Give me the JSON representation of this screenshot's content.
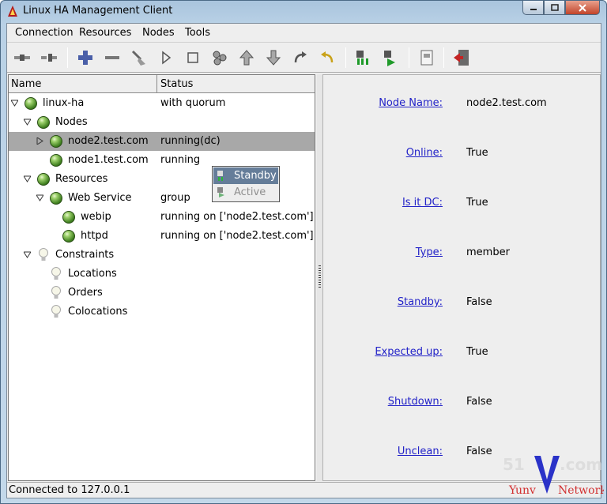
{
  "window": {
    "title": "Linux HA Management Client",
    "controls": [
      "minimize",
      "maximize",
      "close"
    ]
  },
  "menu": [
    "Connection",
    "Resources",
    "Nodes",
    "Tools"
  ],
  "toolbar": {
    "buttons": [
      "connect-icon",
      "disconnect-icon",
      "add-icon",
      "remove-icon",
      "cleanup-icon",
      "start-icon",
      "stop-icon",
      "migrate-icon",
      "move-up-icon",
      "move-down-icon",
      "redo-icon",
      "undo-icon",
      "standby-icon",
      "active-icon",
      "view-icon",
      "exit-icon"
    ]
  },
  "tree": {
    "headers": {
      "name": "Name",
      "status": "Status"
    },
    "rows": [
      {
        "label": "linux-ha",
        "status": "with quorum"
      },
      {
        "label": "Nodes",
        "status": ""
      },
      {
        "label": "node2.test.com",
        "status": "running(dc)"
      },
      {
        "label": "node1.test.com",
        "status": "running"
      },
      {
        "label": "Resources",
        "status": ""
      },
      {
        "label": "Web Service",
        "status": "group"
      },
      {
        "label": "webip",
        "status": "running on ['node2.test.com']"
      },
      {
        "label": "httpd",
        "status": "running on ['node2.test.com']"
      },
      {
        "label": "Constraints",
        "status": ""
      },
      {
        "label": "Locations",
        "status": ""
      },
      {
        "label": "Orders",
        "status": ""
      },
      {
        "label": "Colocations",
        "status": ""
      }
    ]
  },
  "context_menu": {
    "items": [
      {
        "label": "Standby",
        "state": "highlighted"
      },
      {
        "label": "Active",
        "state": "disabled"
      }
    ]
  },
  "properties": [
    {
      "label": "Node Name:",
      "value": "node2.test.com"
    },
    {
      "label": "Online:",
      "value": "True"
    },
    {
      "label": "Is it DC:",
      "value": "True"
    },
    {
      "label": "Type:",
      "value": "member"
    },
    {
      "label": "Standby:",
      "value": "False"
    },
    {
      "label": "Expected up:",
      "value": "True"
    },
    {
      "label": "Shutdown:",
      "value": "False"
    },
    {
      "label": "Unclean:",
      "value": "False"
    }
  ],
  "status_bar": "Connected to 127.0.0.1",
  "watermark": "51CTO.com Yunv Network",
  "colors": {
    "selection": "#a8a8a8",
    "menu_highlight": "#657d99",
    "link": "#2323c8",
    "node_ok": "#3f7f1f"
  }
}
